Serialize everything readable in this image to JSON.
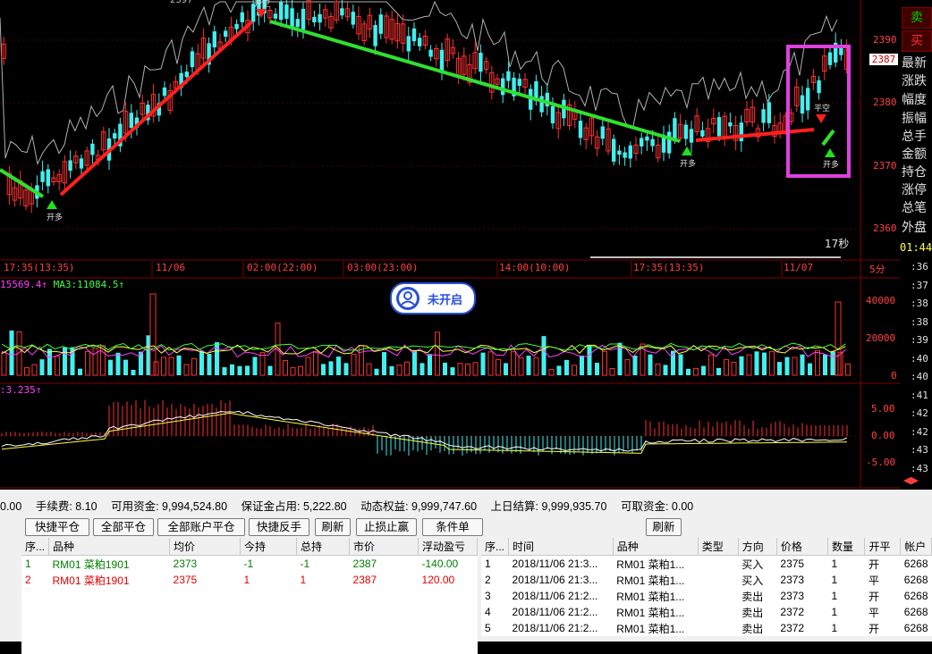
{
  "price_axis": [
    "2390",
    "2380",
    "2370",
    "2360"
  ],
  "current_price_tag": "2387",
  "top_peak_label": "2397",
  "countdown": "17秒",
  "chart_markers": {
    "open_long": "开多",
    "open_short": "开空",
    "close_short": "平空",
    "one": "1"
  },
  "time_axis": [
    "17:35(13:35)",
    "11/06",
    "02:00(22:00)",
    "03:00(23:00)",
    "14:00(10:00)",
    "17:35(13:35)",
    "11/07",
    "5分"
  ],
  "volume_indicator": {
    "left": "15569.4",
    "arrow": "↑",
    "ma3": "MA3:11084.5",
    "ma3_arrow": "↑"
  },
  "volume_axis": [
    "40000",
    "20000",
    "0"
  ],
  "macd_indicator": {
    "label": ":3.235",
    "arrow": "↑"
  },
  "macd_axis": [
    "5.00",
    "0.00",
    "-5.00"
  ],
  "status_pill": {
    "text": "未开启"
  },
  "right_panel": {
    "sell_label": "卖",
    "buy_label": "买",
    "items": [
      "最新",
      "涨跌",
      "幅度",
      "振幅",
      "总手",
      "金额",
      "持仓",
      "涨停",
      "总笔",
      "外盘"
    ],
    "time": "01:44",
    "ticks": [
      ":36",
      ":37",
      ":38",
      ":38",
      ":39",
      ":40",
      ":40",
      ":41",
      ":42",
      ":42",
      ":43",
      ":43"
    ]
  },
  "account": {
    "left_cut": "0.00",
    "fee": "手续费: 8.10",
    "available": "可用资金: 9,994,524.80",
    "margin": "保证金占用: 5,222.80",
    "equity": "动态权益: 9,999,747.60",
    "prev_settle": "上日结算: 9,999,935.70",
    "withdrawable": "可取资金: 0.00"
  },
  "buttons": {
    "quick_close": "快捷平仓",
    "close_all": "全部平仓",
    "close_all_accounts": "全部账户平仓",
    "quick_reverse": "快捷反手",
    "refresh": "刷新",
    "stop": "止损止赢",
    "conditional": "条件单",
    "refresh2": "刷新"
  },
  "positions": {
    "headers": [
      "序...",
      "品种",
      "均价",
      "今持",
      "总持",
      "市价",
      "浮动盈亏"
    ],
    "rows": [
      [
        "1",
        "RM01 菜粕1901",
        "2373",
        "-1",
        "-1",
        "2387",
        "-140.00"
      ],
      [
        "2",
        "RM01 菜粕1901",
        "2375",
        "1",
        "1",
        "2387",
        "120.00"
      ]
    ]
  },
  "trades": {
    "headers": [
      "序...",
      "时间",
      "品种",
      "类型",
      "方向",
      "价格",
      "数量",
      "开平",
      "帐户"
    ],
    "rows": [
      [
        "1",
        "2018/11/06 21:3...",
        "RM01 菜粕1...",
        "",
        "买入",
        "2375",
        "1",
        "开",
        "6268"
      ],
      [
        "2",
        "2018/11/06 21:3...",
        "RM01 菜粕1...",
        "",
        "买入",
        "2373",
        "1",
        "平",
        "6268"
      ],
      [
        "3",
        "2018/11/06 21:2...",
        "RM01 菜粕1...",
        "",
        "卖出",
        "2373",
        "1",
        "开",
        "6268"
      ],
      [
        "4",
        "2018/11/06 21:2...",
        "RM01 菜粕1...",
        "",
        "卖出",
        "2372",
        "1",
        "平",
        "6268"
      ],
      [
        "5",
        "2018/11/06 21:2...",
        "RM01 菜粕1...",
        "",
        "卖出",
        "2372",
        "1",
        "开",
        "6268"
      ]
    ]
  },
  "colors": {
    "up": "#ff3030",
    "down": "#40f0f0",
    "trend_up": "#ff2020",
    "trend_down": "#30e030",
    "highlight": "#e040e0"
  }
}
